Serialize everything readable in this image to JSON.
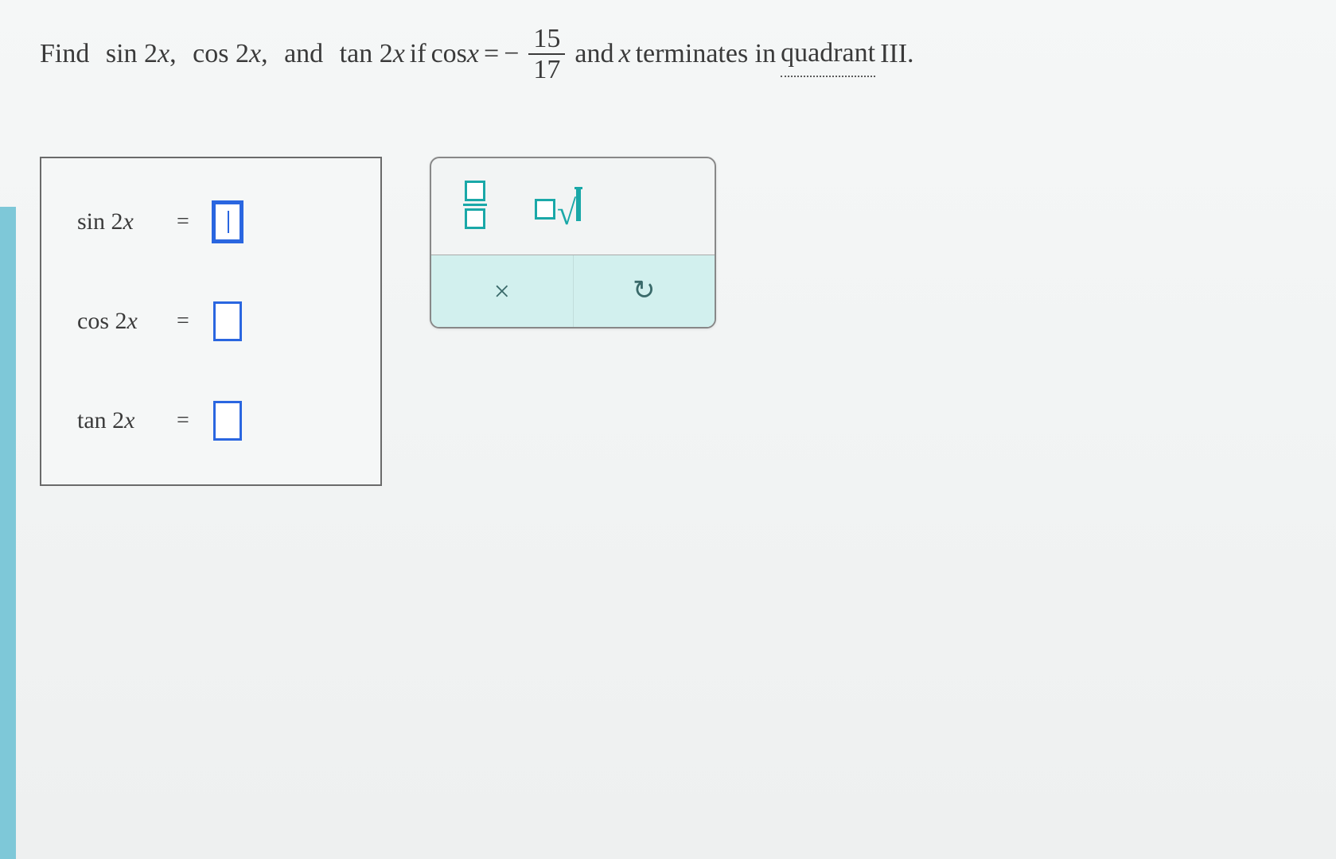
{
  "question": {
    "prefix": "Find",
    "f1": "sin 2",
    "var": "x",
    "comma1": ",",
    "f2": "cos 2",
    "comma2": ",",
    "and1": "and",
    "f3": "tan 2",
    "ifword": " if ",
    "cosx": "cos",
    "eq": " = ",
    "neg": "−",
    "frac_num": "15",
    "frac_den": "17",
    "and2": " and ",
    "terminates": " terminates in ",
    "quadrant": "quadrant",
    "roman": " III."
  },
  "answers": {
    "sin_label": "sin 2",
    "cos_label": "cos 2",
    "tan_label": "tan 2",
    "var": "x",
    "eq": "="
  },
  "tools": {
    "clear": "×",
    "reset": "↺"
  }
}
